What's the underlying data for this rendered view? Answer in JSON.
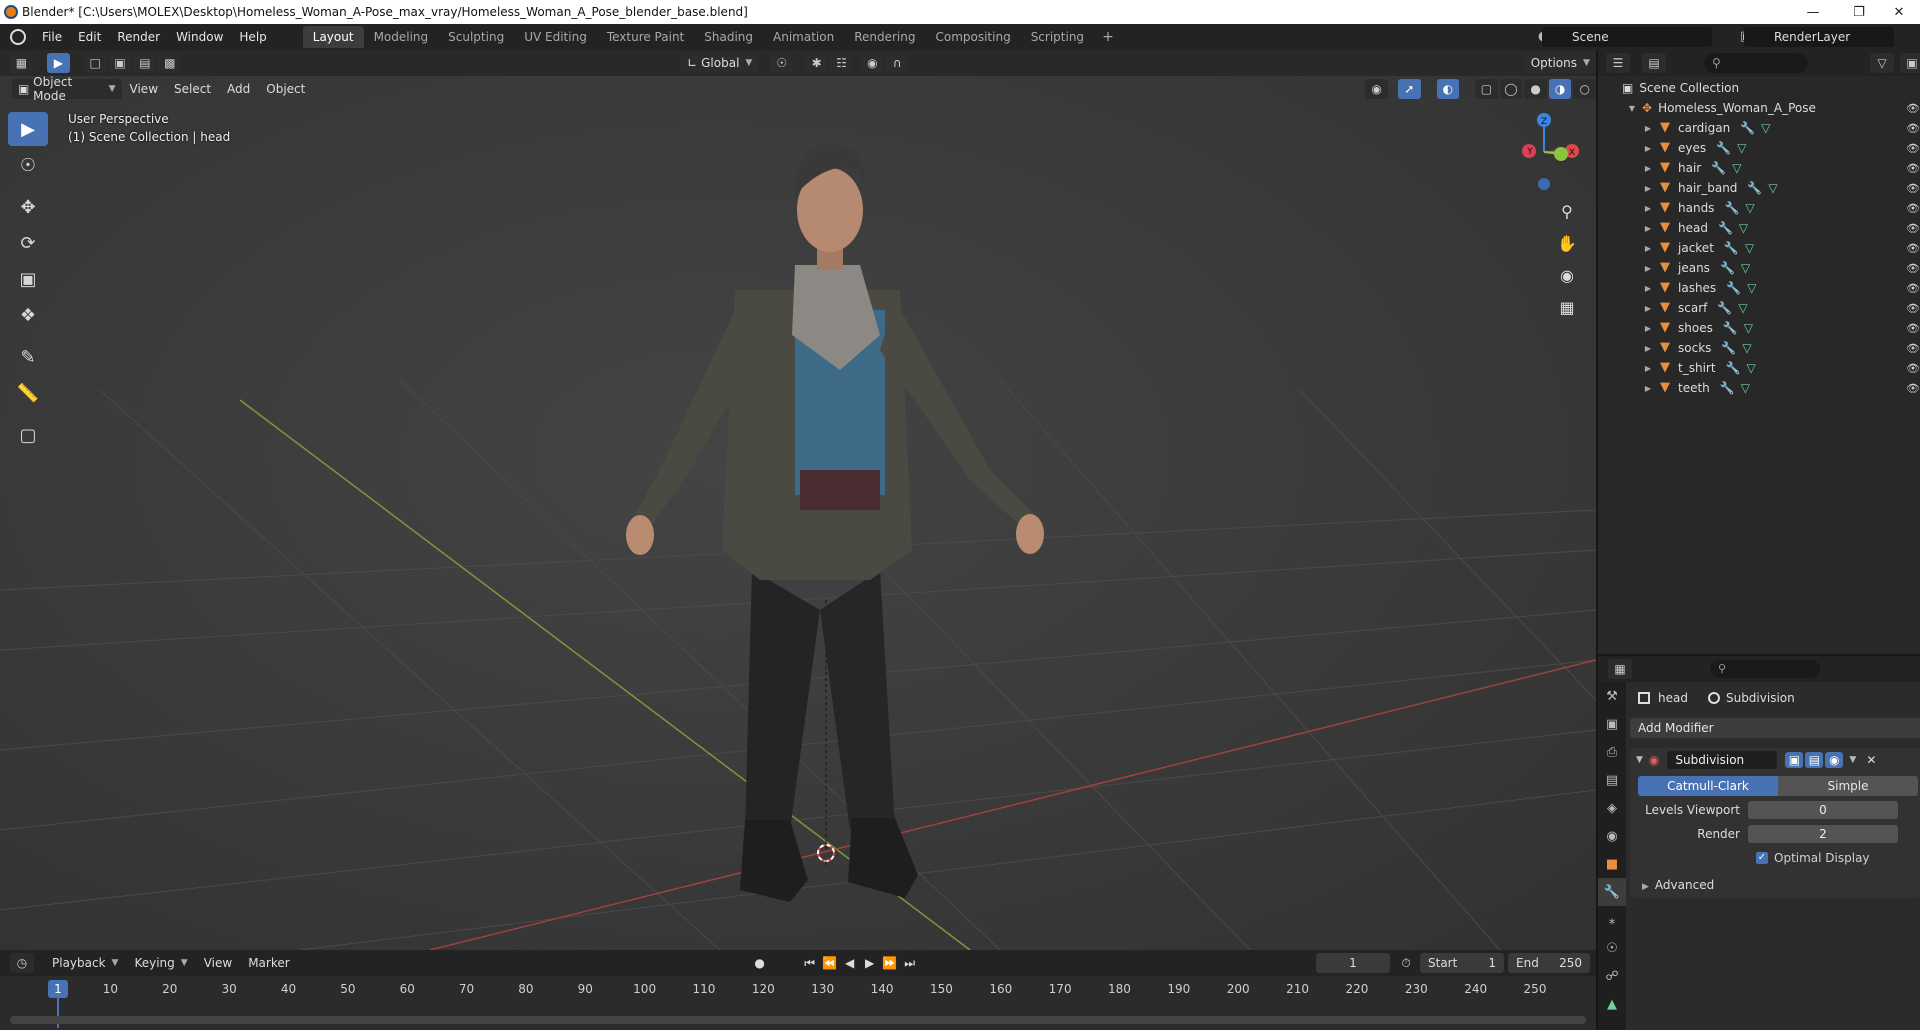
{
  "window": {
    "title": "Blender* [C:\\Users\\MOLEX\\Desktop\\Homeless_Woman_A-Pose_max_vray/Homeless_Woman_A_Pose_blender_base.blend]"
  },
  "menu": {
    "items": [
      "File",
      "Edit",
      "Render",
      "Window",
      "Help"
    ]
  },
  "workspaces": {
    "tabs": [
      "Layout",
      "Modeling",
      "Sculpting",
      "UV Editing",
      "Texture Paint",
      "Shading",
      "Animation",
      "Rendering",
      "Compositing",
      "Scripting"
    ],
    "active": "Layout",
    "add": "+"
  },
  "scene": {
    "name": "Scene",
    "render_layer": "RenderLayer"
  },
  "viewport": {
    "mode": "Object Mode",
    "menus": [
      "View",
      "Select",
      "Add",
      "Object"
    ],
    "transform_orientation": "Global",
    "options_label": "Options",
    "info_line1": "User Perspective",
    "info_line2": "(1) Scene Collection | head",
    "gizmo": {
      "x": "X",
      "y": "Y",
      "z": "Z"
    }
  },
  "outliner": {
    "root": "Scene Collection",
    "collection": "Homeless_Woman_A_Pose",
    "objects": [
      "cardigan",
      "eyes",
      "hair",
      "hair_band",
      "hands",
      "head",
      "jacket",
      "jeans",
      "lashes",
      "scarf",
      "shoes",
      "socks",
      "t_shirt",
      "teeth"
    ]
  },
  "properties": {
    "object": "head",
    "modifier_crumb": "Subdivision",
    "add_modifier": "Add Modifier",
    "modifier": {
      "name": "Subdivision",
      "type_on": "Catmull-Clark",
      "type_off": "Simple",
      "levels_viewport_label": "Levels Viewport",
      "levels_viewport": "0",
      "render_label": "Render",
      "render": "2",
      "optimal_display": "Optimal Display",
      "advanced": "Advanced"
    }
  },
  "timeline": {
    "menus": [
      "Playback",
      "Keying",
      "View",
      "Marker"
    ],
    "current_frame": "1",
    "start_label": "Start",
    "start": "1",
    "end_label": "End",
    "end": "250",
    "ticks": [
      "1",
      "10",
      "20",
      "30",
      "40",
      "50",
      "60",
      "70",
      "80",
      "90",
      "100",
      "110",
      "120",
      "130",
      "140",
      "150",
      "160",
      "170",
      "180",
      "190",
      "200",
      "210",
      "220",
      "230",
      "240",
      "250"
    ]
  },
  "colors": {
    "accent": "#4772b3",
    "mesh_icon": "#e8903c",
    "x_axis": "#e04848",
    "y_axis": "#8cc63f",
    "z_axis": "#3a86e0"
  }
}
